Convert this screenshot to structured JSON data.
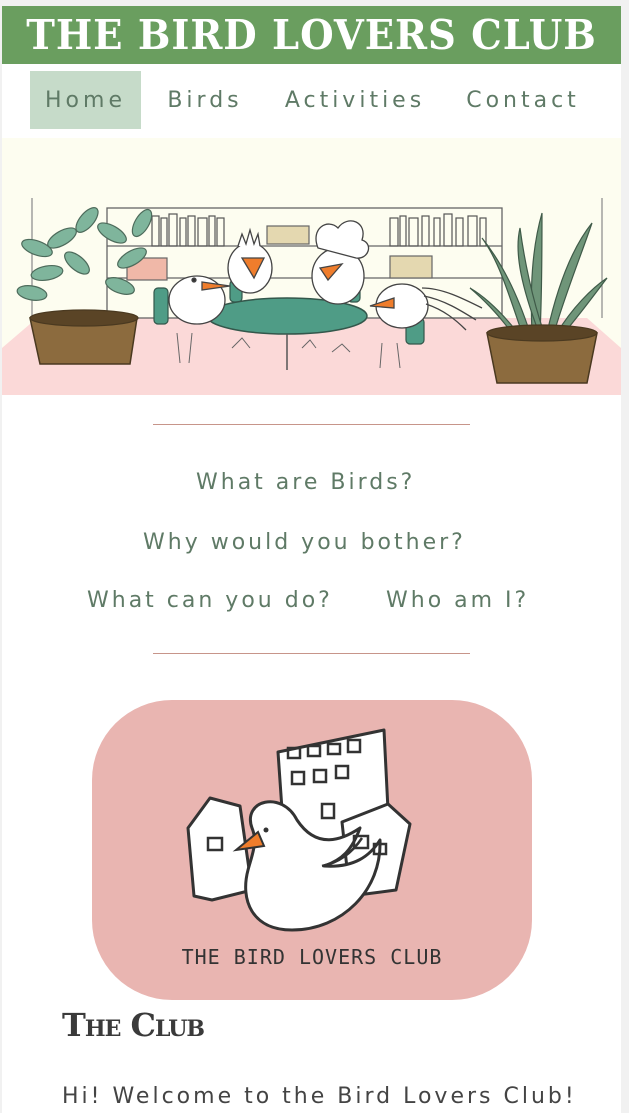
{
  "header": {
    "title": "THE BIRD LOVERS CLUB"
  },
  "nav": {
    "items": [
      {
        "label": "Home",
        "active": true
      },
      {
        "label": "Birds",
        "active": false
      },
      {
        "label": "Activities",
        "active": false
      },
      {
        "label": "Contact",
        "active": false
      }
    ]
  },
  "links": {
    "what_are_birds": "What are Birds?",
    "why_bother": "Why would you bother?",
    "what_can_you_do": "What can you do?",
    "who_am_i": "Who am I?"
  },
  "logo": {
    "text": "THE  BIRD  LOVERS  CLUB"
  },
  "section": {
    "heading": "The Club",
    "welcome": "Hi! Welcome to the Bird Lovers Club!"
  },
  "colors": {
    "banner": "#6a9e5f",
    "nav_active": "#c6dbc9",
    "nav_text": "#5f7a66",
    "divider": "#c7958a",
    "logo_bg": "#e9b5b1"
  },
  "icons": {
    "hero": "birds-meeting-illustration",
    "logo": "bird-and-houses-logo"
  }
}
